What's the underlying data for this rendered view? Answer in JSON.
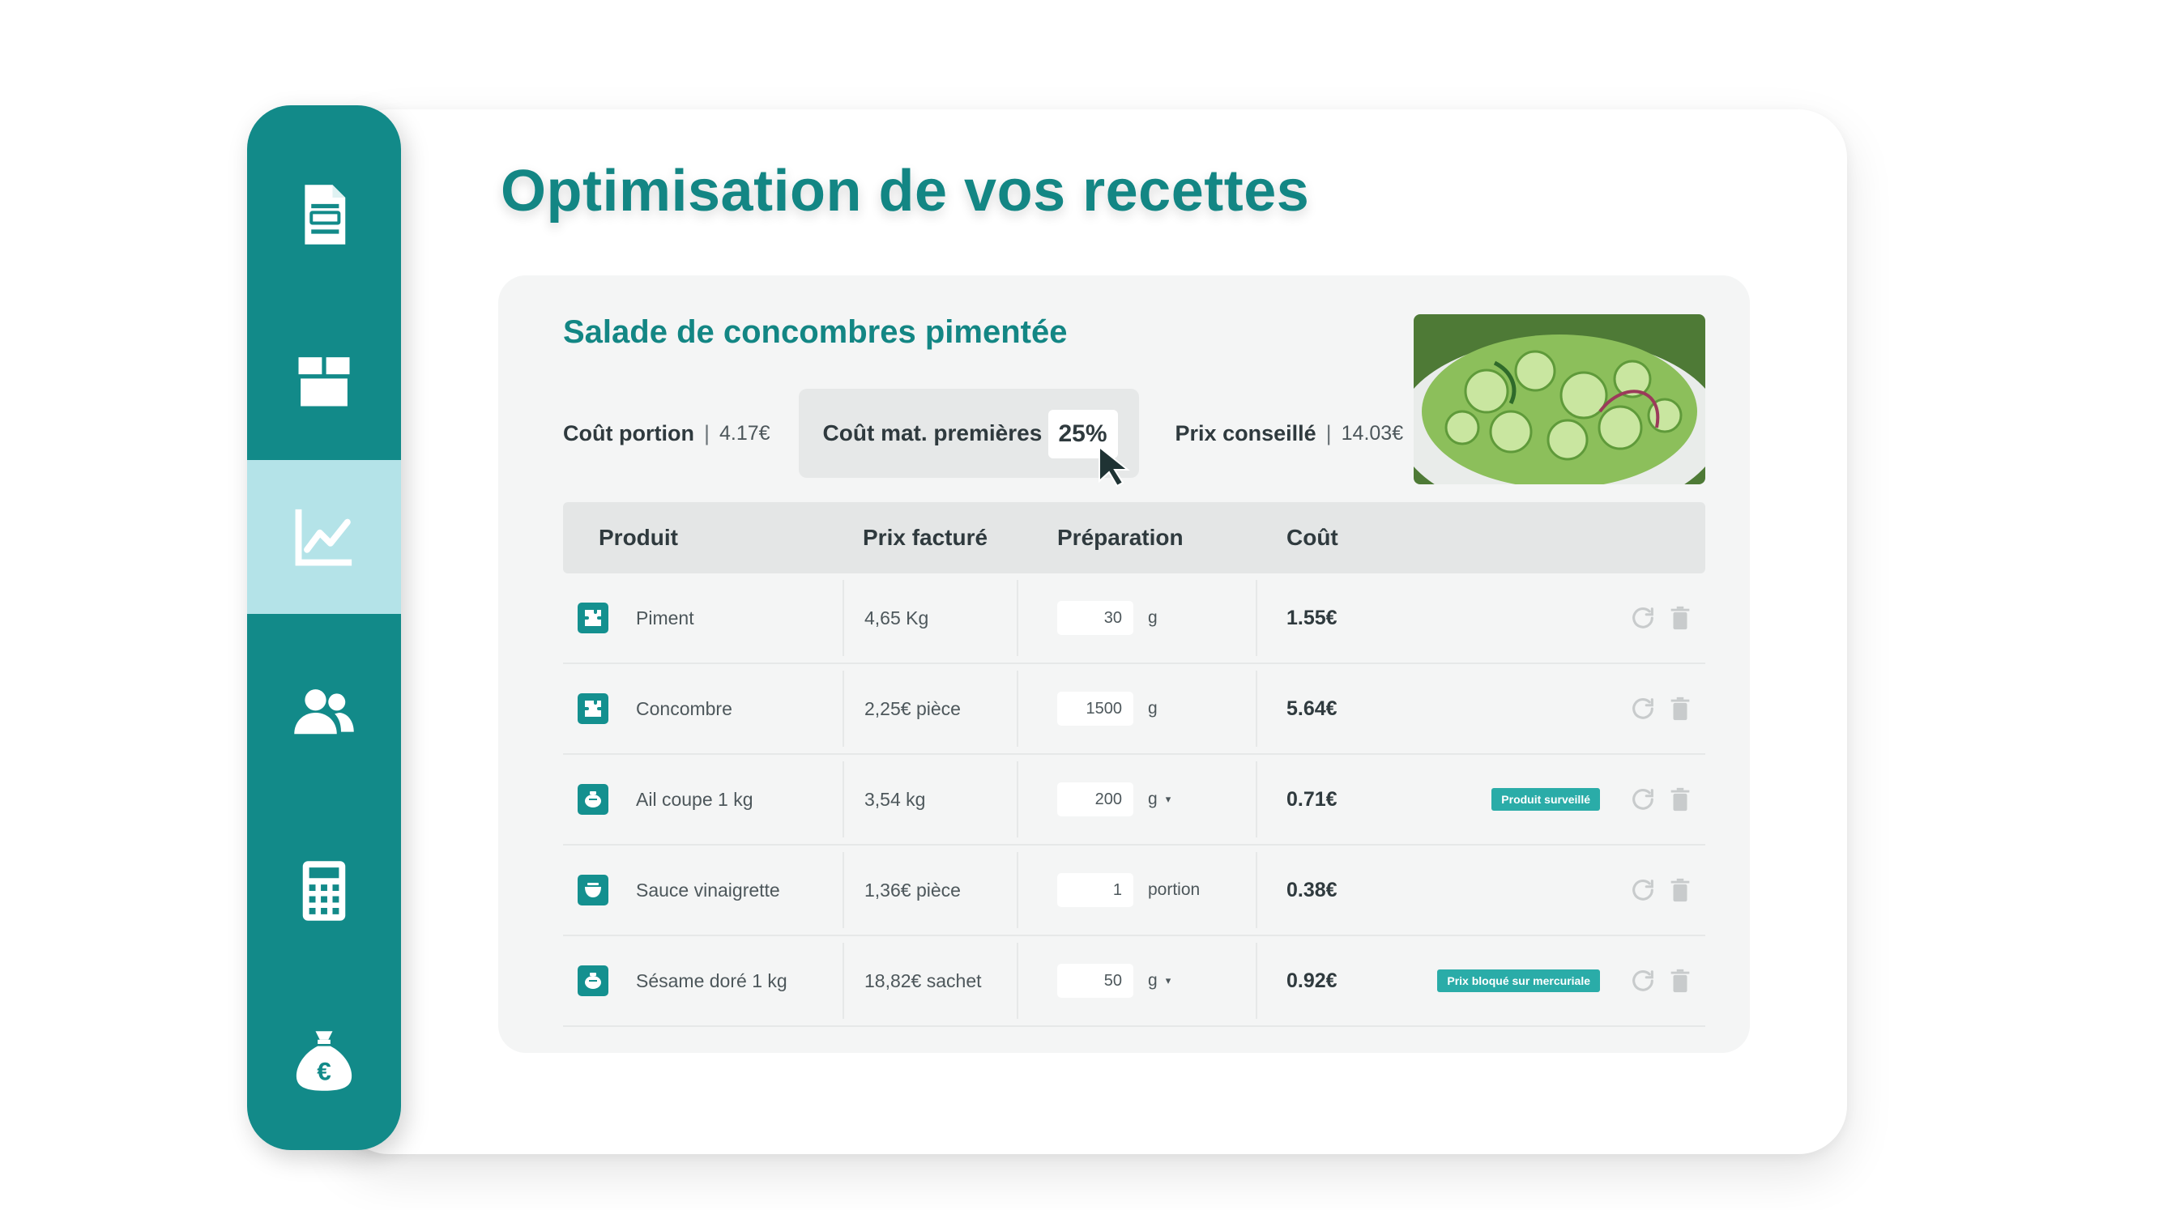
{
  "page": {
    "title": "Optimisation de vos recettes"
  },
  "sidebar": {
    "items": [
      {
        "icon": "document-icon",
        "active": false
      },
      {
        "icon": "box-icon",
        "active": false
      },
      {
        "icon": "chart-line-icon",
        "active": true
      },
      {
        "icon": "users-icon",
        "active": false
      },
      {
        "icon": "calculator-icon",
        "active": false
      },
      {
        "icon": "money-bag-euro-icon",
        "active": false
      }
    ]
  },
  "recipe": {
    "name": "Salade de concombres pimentée",
    "cost_portion_label": "Coût portion",
    "cost_portion_value": "4.17€",
    "raw_material_label": "Coût mat. premières",
    "raw_material_value": "25%",
    "suggested_price_label": "Prix conseillé",
    "suggested_price_value": "14.03€",
    "separator": "|"
  },
  "table": {
    "headers": {
      "product": "Produit",
      "price": "Prix facturé",
      "prep": "Préparation",
      "cost": "Coût"
    },
    "rows": [
      {
        "icon": "puzzle-icon",
        "product": "Piment",
        "price": "4,65 Kg",
        "qty": "30",
        "unit": "g",
        "dropdown": false,
        "cost": "1.55€",
        "badge": ""
      },
      {
        "icon": "puzzle-icon",
        "product": "Concombre",
        "price": "2,25€ pièce",
        "qty": "1500",
        "unit": "g",
        "dropdown": false,
        "cost": "5.64€",
        "badge": ""
      },
      {
        "icon": "pot-icon",
        "product": "Ail coupe 1 kg",
        "price": "3,54 kg",
        "qty": "200",
        "unit": "g",
        "dropdown": true,
        "cost": "0.71€",
        "badge": "Produit surveillé"
      },
      {
        "icon": "bowl-icon",
        "product": "Sauce vinaigrette",
        "price": "1,36€ pièce",
        "qty": "1",
        "unit": "portion",
        "dropdown": false,
        "cost": "0.38€",
        "badge": ""
      },
      {
        "icon": "pot-icon",
        "product": "Sésame doré 1 kg",
        "price": "18,82€ sachet",
        "qty": "50",
        "unit": "g",
        "dropdown": true,
        "cost": "0.92€",
        "badge": "Prix bloqué sur mercuriale"
      }
    ]
  },
  "colors": {
    "primary": "#128a89",
    "active_nav": "#b4e3e8",
    "title": "#138684",
    "badge": "#2aaca8"
  }
}
